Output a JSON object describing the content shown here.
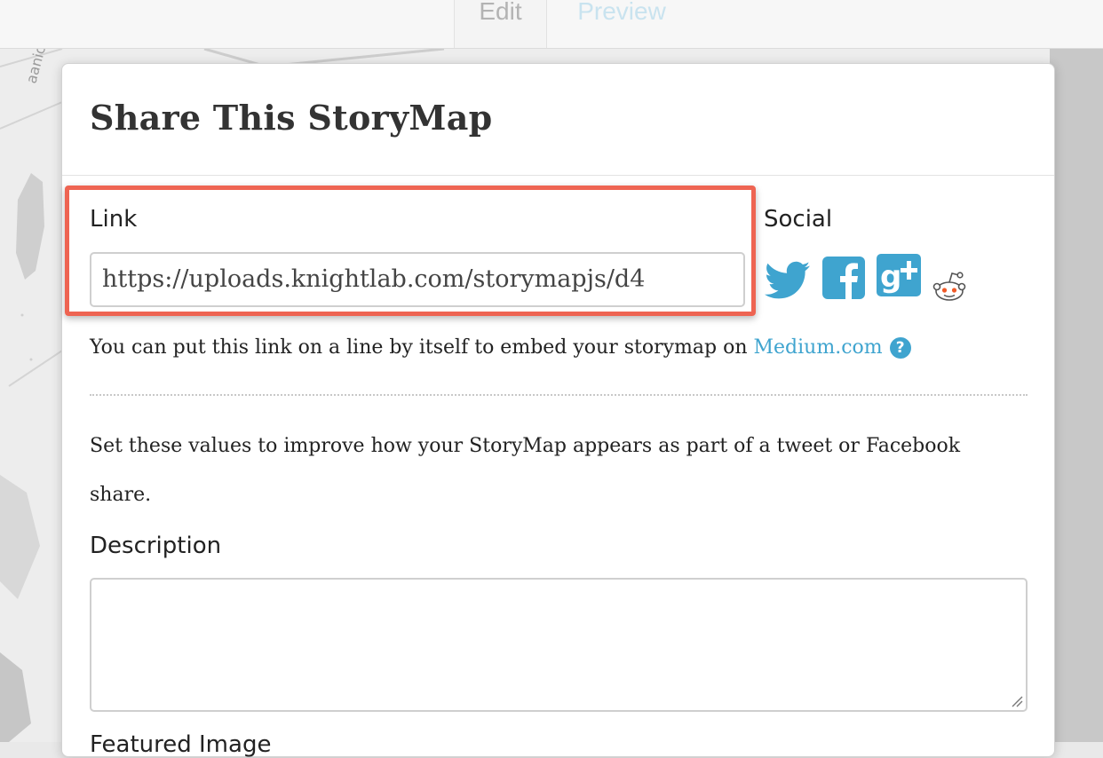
{
  "tabs": [
    {
      "label": "Edit"
    },
    {
      "label": "Preview"
    }
  ],
  "modal": {
    "title": "Share This StoryMap",
    "link_label": "Link",
    "link_value": "https://uploads.knightlab.com/storymapjs/d4",
    "social_label": "Social",
    "social_icons": [
      "twitter-icon",
      "facebook-icon",
      "google-plus-icon",
      "reddit-icon"
    ],
    "embed_note_text": "You can put this link on a line by itself to embed your storymap on",
    "embed_note_link": "Medium.com",
    "help_glyph": "?",
    "share_note": "Set these values to improve how your StoryMap appears as part of a tweet or Facebook share.",
    "description_label": "Description",
    "next_label_partial": "Featured Image"
  },
  "map_labels": [
    "aanich"
  ],
  "colors": {
    "highlight": "#ee6452",
    "link_blue": "#3fa4cf",
    "tab_preview": "#c9e3ef"
  }
}
